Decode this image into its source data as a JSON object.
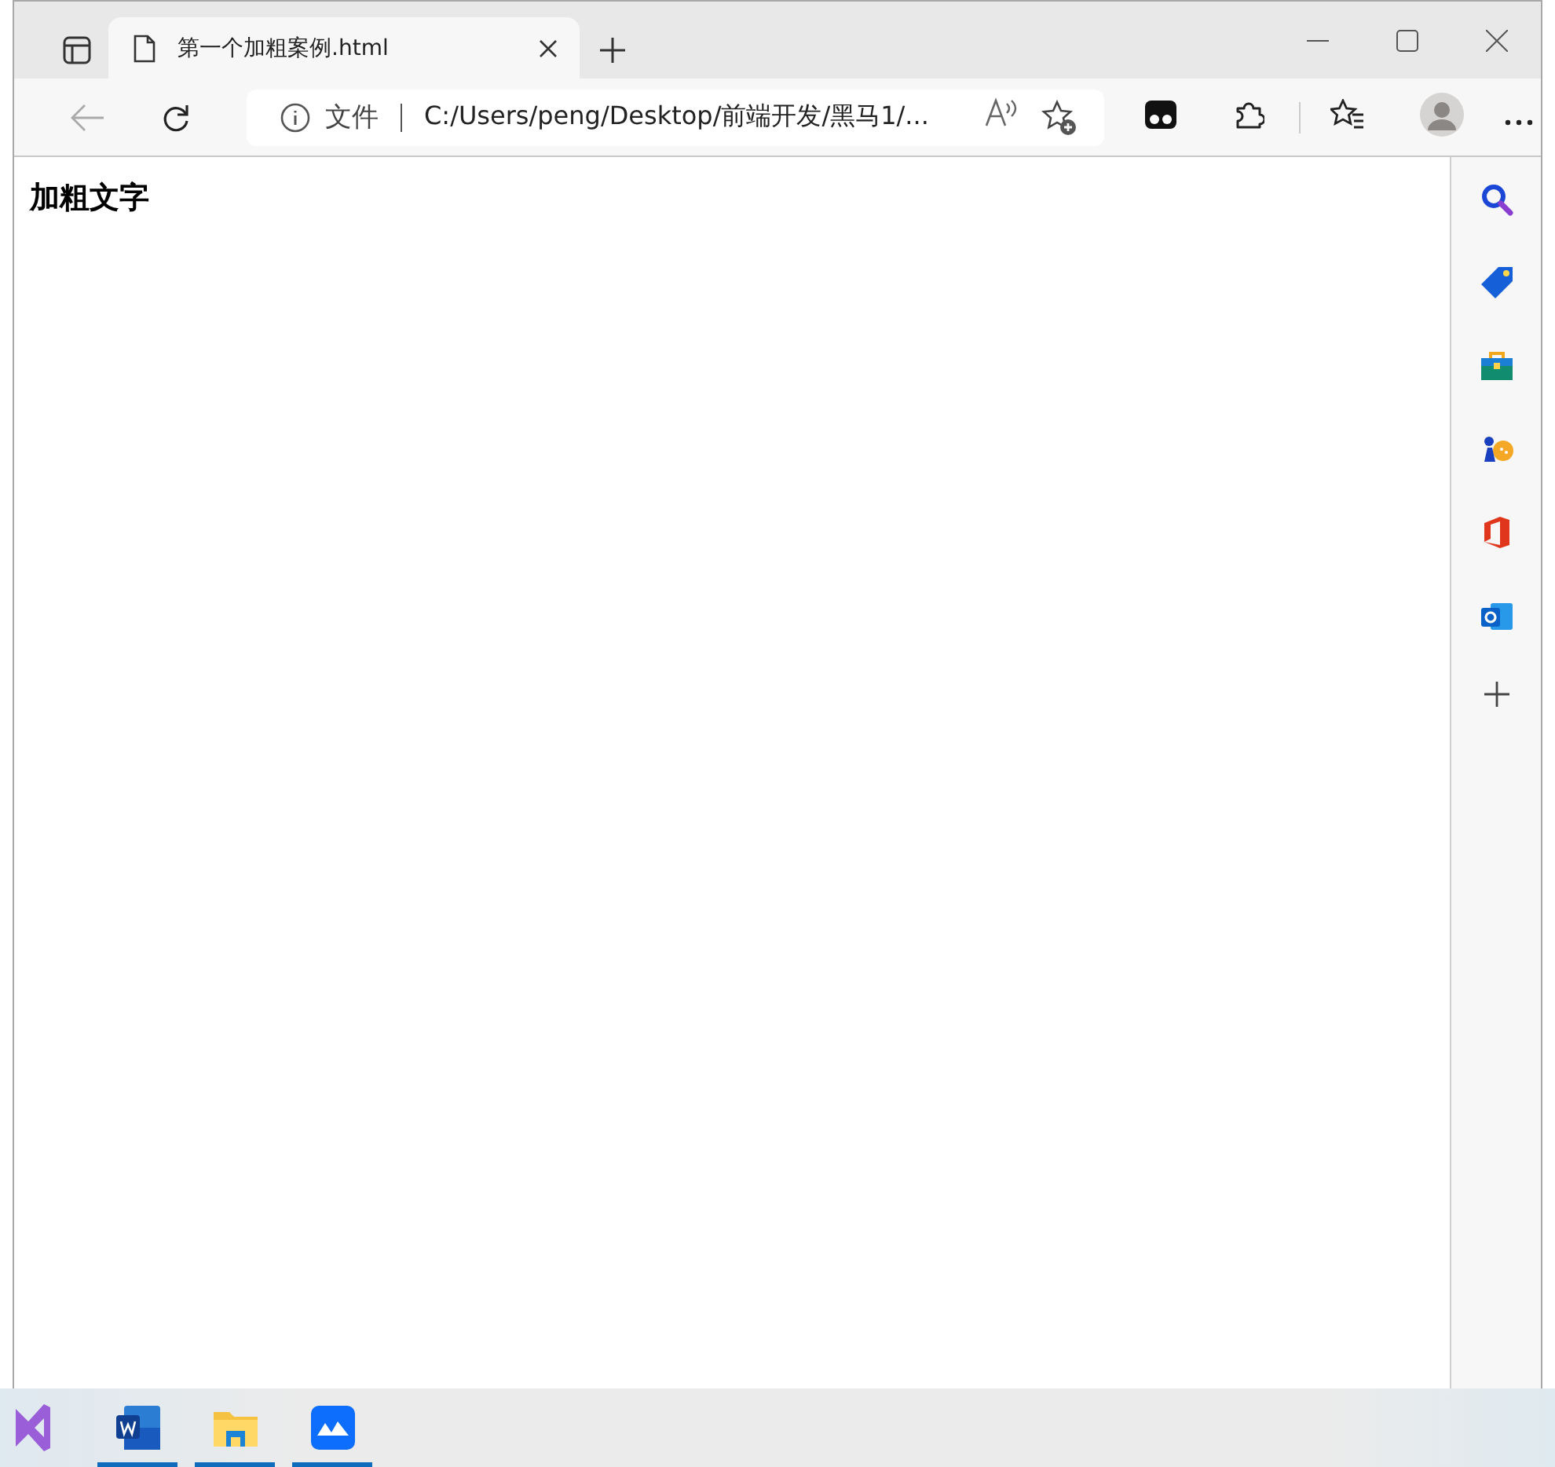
{
  "tabs": [
    {
      "title": "第一个加粗案例.html",
      "selected": true
    }
  ],
  "toolbar": {
    "back_disabled": true
  },
  "address_bar": {
    "security_label": "文件",
    "url": "C:/Users/peng/Desktop/前端开发/黑马1/..."
  },
  "page": {
    "bold_text": "加粗文字"
  },
  "taskbar": {
    "apps": [
      {
        "kind": "visual-studio",
        "running": false
      },
      {
        "kind": "word",
        "running": true
      },
      {
        "kind": "folder",
        "running": true
      },
      {
        "kind": "meeting",
        "running": true
      }
    ]
  }
}
